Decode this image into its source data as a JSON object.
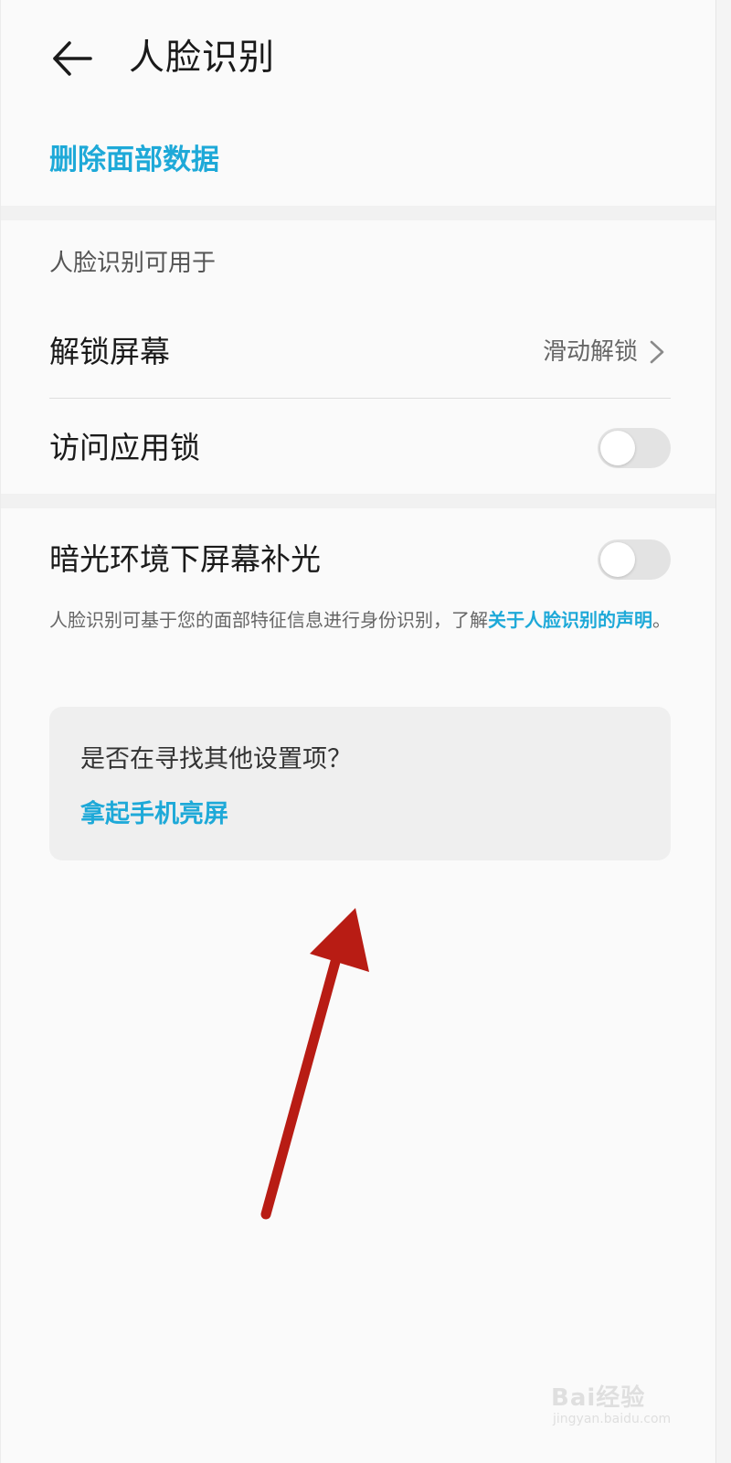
{
  "header": {
    "title": "人脸识别",
    "back_icon": "arrow-left-icon"
  },
  "actions": {
    "delete_face_data": "删除面部数据"
  },
  "usage_section": {
    "caption": "人脸识别可用于",
    "items": [
      {
        "label": "解锁屏幕",
        "value": "滑动解锁",
        "control": "chevron-right-icon"
      },
      {
        "label": "访问应用锁",
        "toggle": false
      }
    ]
  },
  "low_light": {
    "label": "暗光环境下屏幕补光",
    "toggle": false
  },
  "info": {
    "text": "人脸识别可基于您的面部特征信息进行身份识别，了解",
    "link": "关于人脸识别的声明",
    "suffix": "。"
  },
  "suggestion": {
    "title": "是否在寻找其他设置项？",
    "link": "拿起手机亮屏"
  },
  "watermark": {
    "brand": "Bai经验",
    "url": "jingyan.baidu.com"
  },
  "colors": {
    "accent": "#1ea9d8",
    "annotation_arrow": "#b81c14",
    "toggle_off": "#e3e3e3"
  }
}
